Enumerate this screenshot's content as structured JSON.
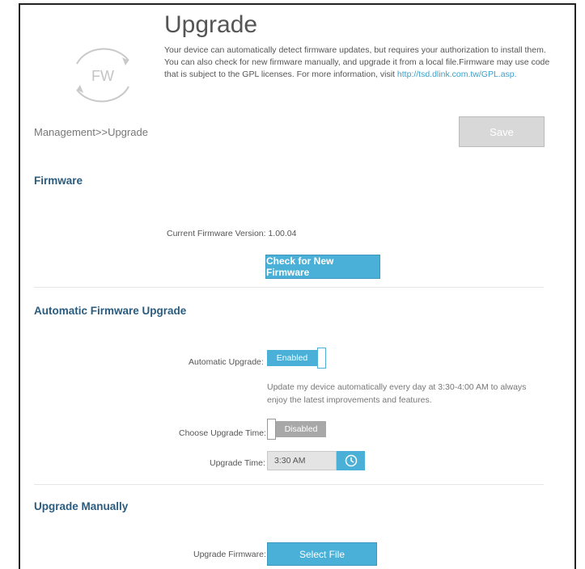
{
  "header": {
    "title": "Upgrade",
    "logo_text": "FW",
    "description": "Your device can automatically detect firmware updates, but requires your authorization to install them. You can also check for new firmware manually, and upgrade it from a local file.Firmware may use code that is subject to the GPL licenses. For more information, visit",
    "link": "http://tsd.dlink.com.tw/GPL.asp."
  },
  "breadcrumb": "Management>>Upgrade",
  "save_label": "Save",
  "firmware": {
    "title": "Firmware",
    "version_label": "Current Firmware Version: 1.00.04",
    "check_button": "Check for New Firmware"
  },
  "auto_upgrade": {
    "title": "Automatic Firmware Upgrade",
    "auto_label": "Automatic Upgrade:",
    "auto_value": "Enabled",
    "note": "Update my device automatically every day at 3:30-4:00 AM to always enjoy the latest improvements and features.",
    "choose_label": "Choose Upgrade Time:",
    "choose_value": "Disabled",
    "time_label": "Upgrade Time:",
    "time_value": "3:30 AM"
  },
  "manual": {
    "title": "Upgrade Manually",
    "firmware_label": "Upgrade Firmware:",
    "select_button": "Select File"
  },
  "colors": {
    "accent": "#4ab0d8",
    "section_title": "#2a5c80"
  },
  "icons": {
    "logo": "firmware-refresh-icon",
    "clock": "clock-icon"
  }
}
